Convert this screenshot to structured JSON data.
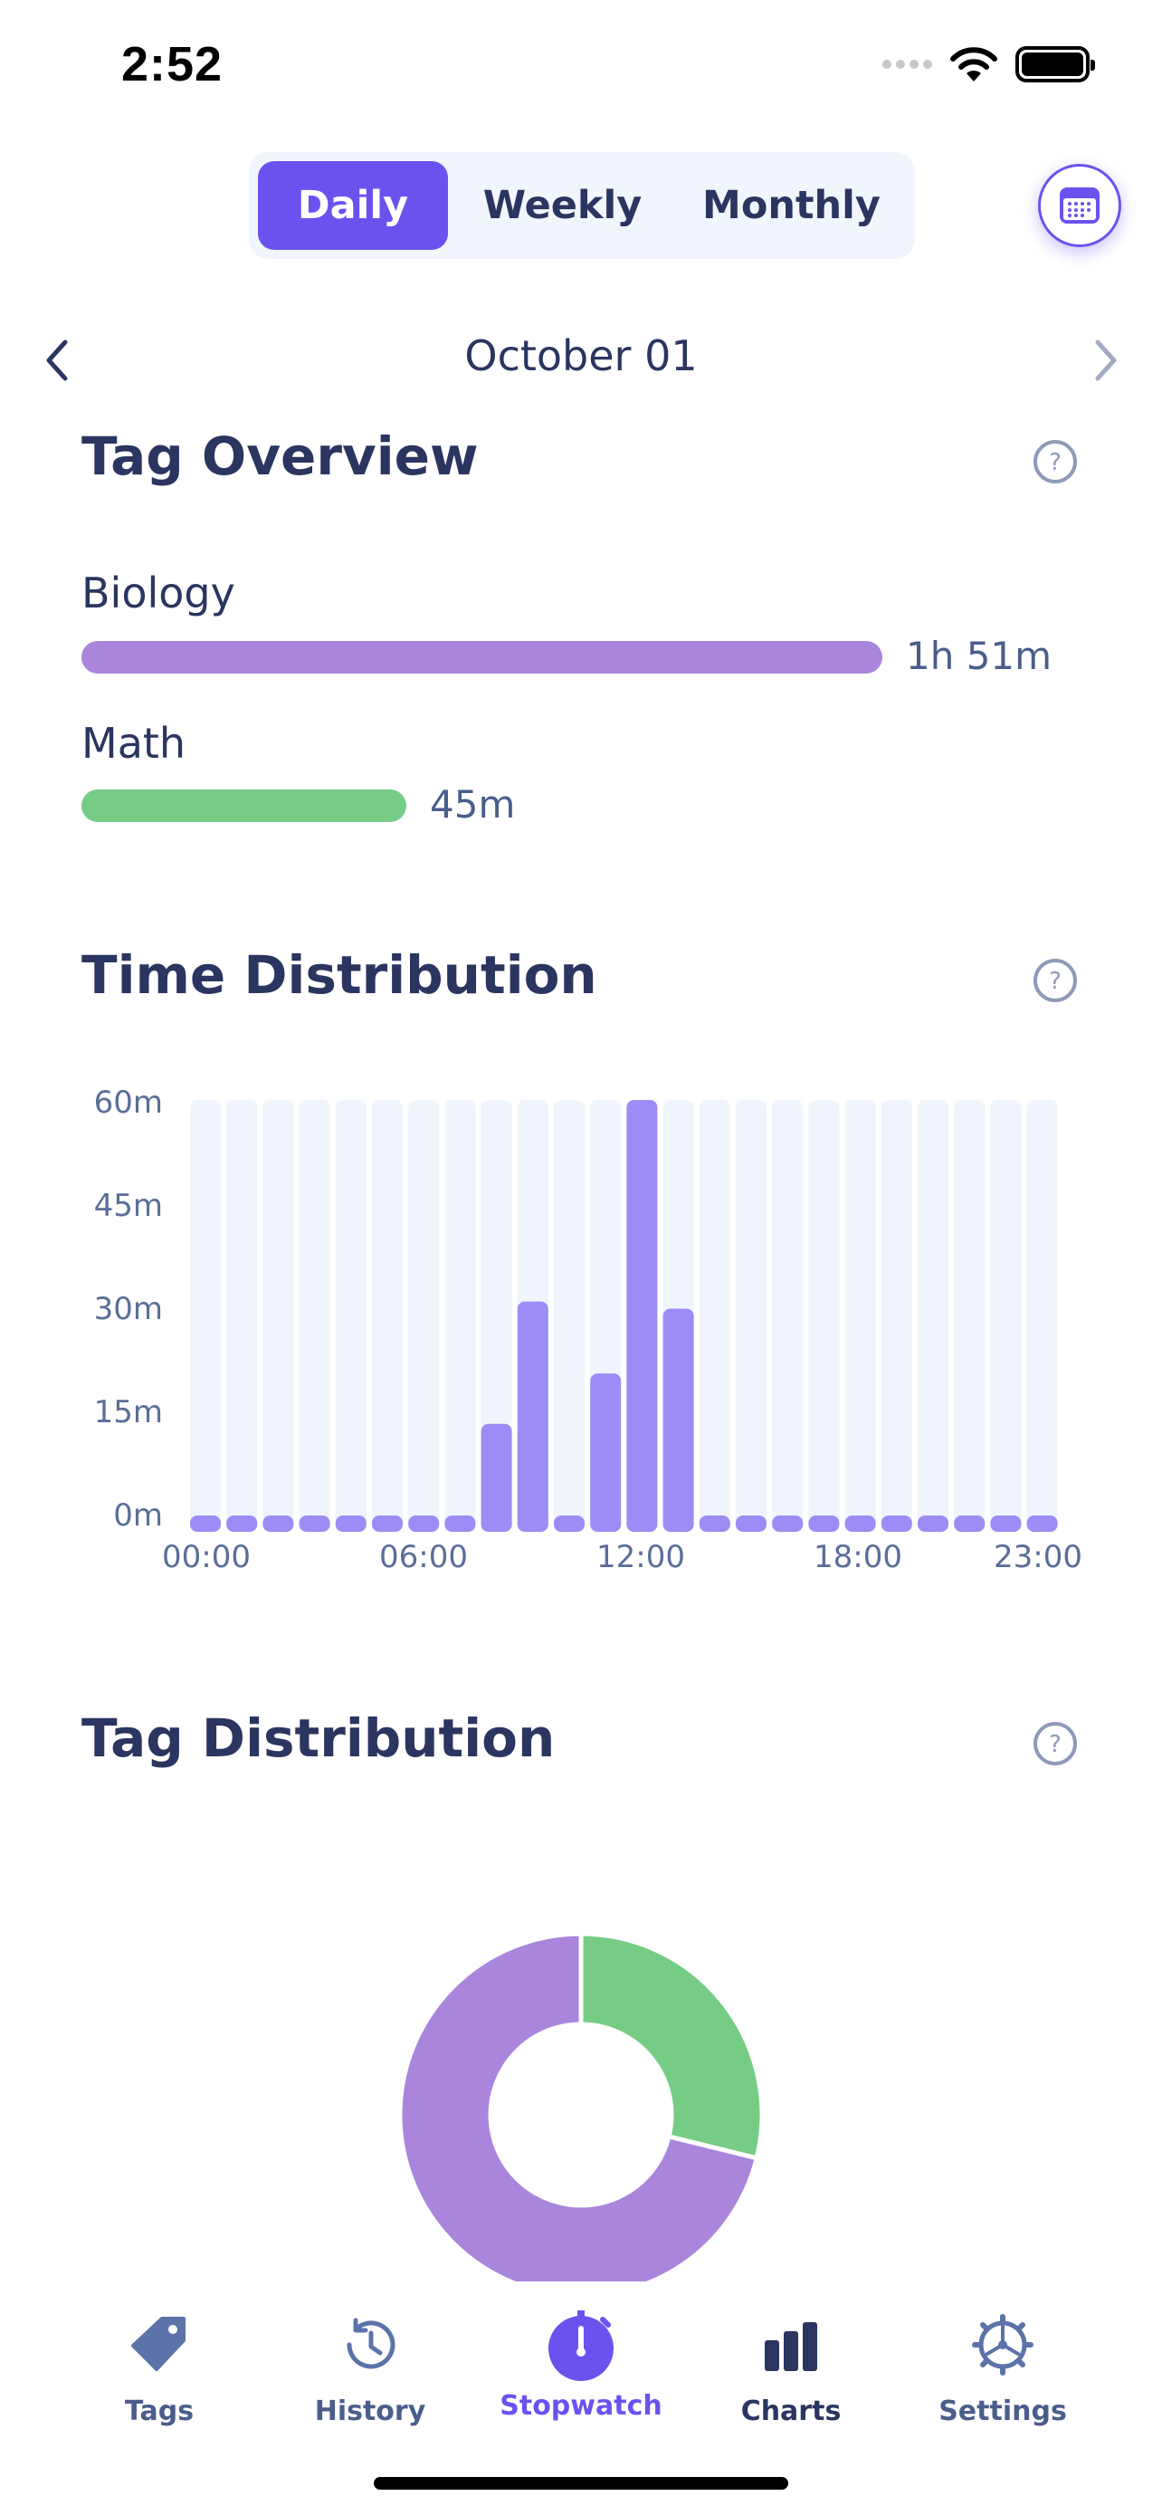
{
  "status_bar": {
    "time": "2:52"
  },
  "period_selector": {
    "options": [
      {
        "label": "Daily",
        "active": true
      },
      {
        "label": "Weekly",
        "active": false
      },
      {
        "label": "Monthly",
        "active": false
      }
    ]
  },
  "date_nav": {
    "date": "October 01"
  },
  "tag_overview": {
    "title": "Tag Overview",
    "tags": [
      {
        "name": "Biology",
        "value": "1h 51m",
        "minutes": 111,
        "color": "#a985dc"
      },
      {
        "name": "Math",
        "value": "45m",
        "minutes": 45,
        "color": "#76cc85"
      }
    ]
  },
  "time_distribution": {
    "title": "Time Distribution"
  },
  "tag_distribution": {
    "title": "Tag Distribution"
  },
  "chart_data": [
    {
      "type": "bar",
      "title": "Time Distribution",
      "categories": [
        "00",
        "01",
        "02",
        "03",
        "04",
        "05",
        "06",
        "07",
        "08",
        "09",
        "10",
        "11",
        "12",
        "13",
        "14",
        "15",
        "16",
        "17",
        "18",
        "19",
        "20",
        "21",
        "22",
        "23"
      ],
      "x_tick_labels": [
        "00:00",
        "06:00",
        "12:00",
        "18:00",
        "23:00"
      ],
      "y_tick_labels": [
        "60m",
        "45m",
        "30m",
        "15m",
        "0m"
      ],
      "values": [
        0,
        0,
        0,
        0,
        0,
        0,
        0,
        0,
        15,
        32,
        0,
        22,
        61,
        31,
        0,
        0,
        0,
        0,
        0,
        0,
        0,
        0,
        0,
        0
      ],
      "ylim": [
        0,
        60
      ],
      "bar_color": "#9d8cf5",
      "track_color": "#f0f4fc"
    },
    {
      "type": "pie",
      "title": "Tag Distribution",
      "labels": [
        "Math",
        "Biology"
      ],
      "values": [
        45,
        111
      ],
      "colors": [
        "#76cc85",
        "#a985dc"
      ]
    }
  ],
  "tab_bar": {
    "items": [
      {
        "label": "Tags",
        "icon": "tag-icon"
      },
      {
        "label": "History",
        "icon": "history-icon"
      },
      {
        "label": "Stopwatch",
        "icon": "stopwatch-icon"
      },
      {
        "label": "Charts",
        "icon": "charts-icon"
      },
      {
        "label": "Settings",
        "icon": "settings-icon"
      }
    ],
    "active": "Charts"
  }
}
